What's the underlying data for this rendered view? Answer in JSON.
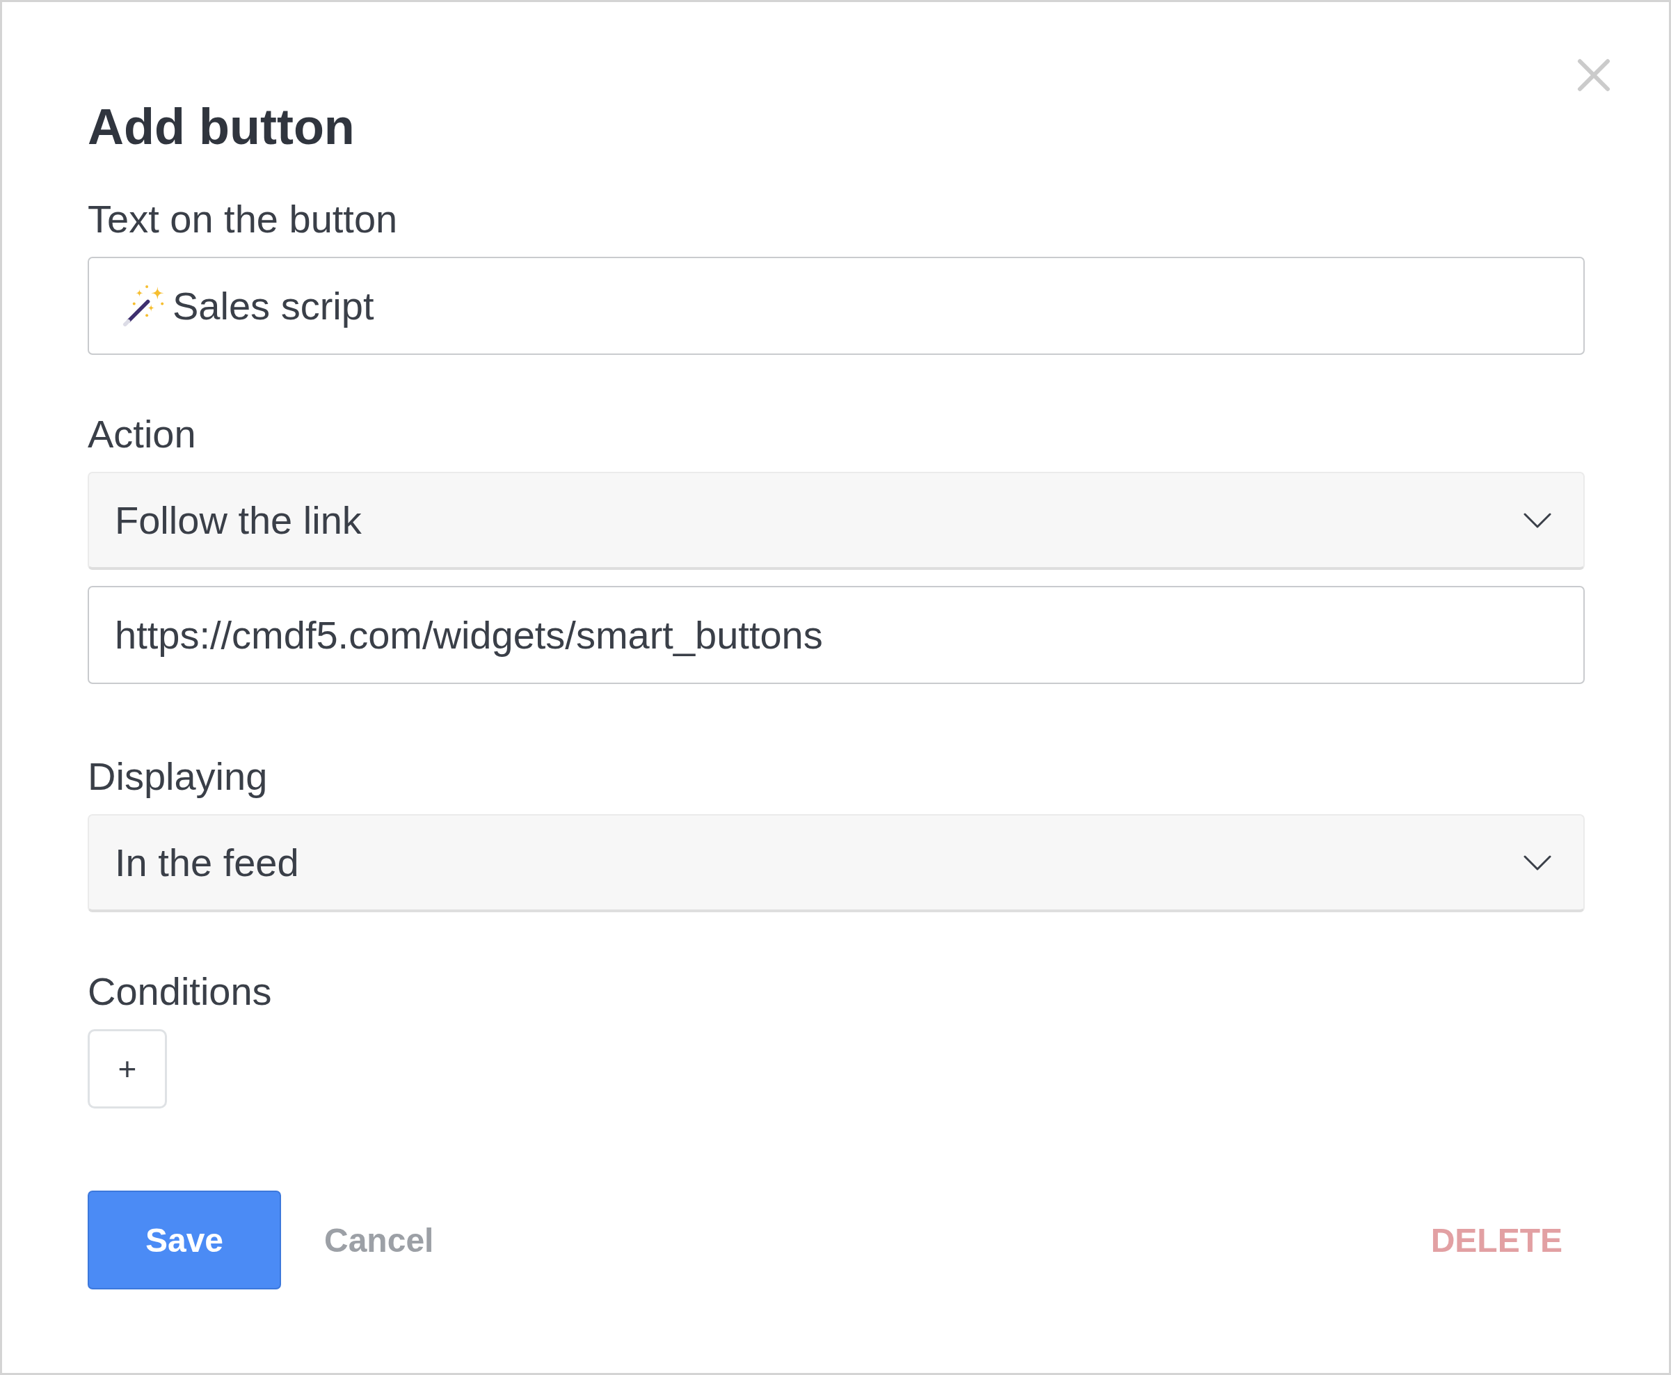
{
  "dialog": {
    "title": "Add button",
    "fields": [
      {
        "label": "Text on the button",
        "controls": [
          {
            "kind": "icontext",
            "value": "Sales script"
          }
        ]
      },
      {
        "label": "Action",
        "controls": [
          {
            "kind": "select",
            "value": "Follow the link"
          },
          {
            "kind": "text",
            "value": "https://cmdf5.com/widgets/smart_buttons"
          }
        ]
      },
      {
        "label": "Displaying",
        "controls": [
          {
            "kind": "select",
            "value": "In the feed"
          }
        ]
      },
      {
        "label": "Conditions",
        "controls": [
          {
            "kind": "add",
            "text": "+"
          }
        ]
      }
    ],
    "buttons": [
      {
        "kind": "primary",
        "label": "Save"
      },
      {
        "kind": "secondary",
        "label": "Cancel"
      },
      {
        "kind": "danger",
        "label": "DELETE"
      }
    ]
  }
}
